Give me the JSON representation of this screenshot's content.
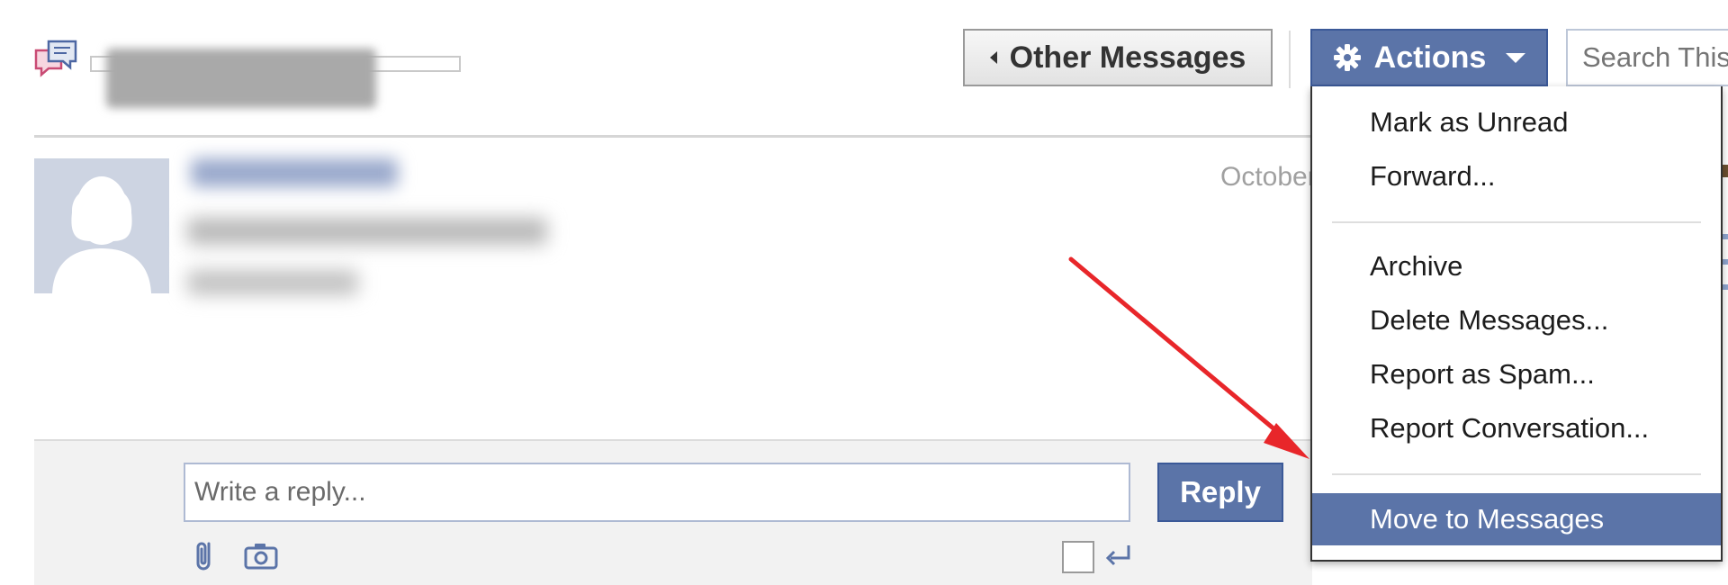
{
  "header": {
    "other_messages_label": "Other Messages",
    "actions_label": "Actions",
    "search_placeholder": "Search This"
  },
  "message": {
    "date": "October"
  },
  "reply": {
    "placeholder": "Write a reply...",
    "button_label": "Reply"
  },
  "actions_menu": {
    "items": [
      {
        "label": "Mark as Unread"
      },
      {
        "label": "Forward..."
      },
      {
        "label": "Archive"
      },
      {
        "label": "Delete Messages..."
      },
      {
        "label": "Report as Spam..."
      },
      {
        "label": "Report Conversation..."
      },
      {
        "label": "Move to Messages",
        "highlighted": true
      }
    ]
  },
  "colors": {
    "accent_blue": "#5b74a8",
    "annotation_arrow": "#e8262a"
  },
  "icons": [
    "messages-icon",
    "gear-icon",
    "caret-down-icon",
    "paperclip-icon",
    "camera-icon",
    "enter-key-icon",
    "arrow-left-icon"
  ]
}
